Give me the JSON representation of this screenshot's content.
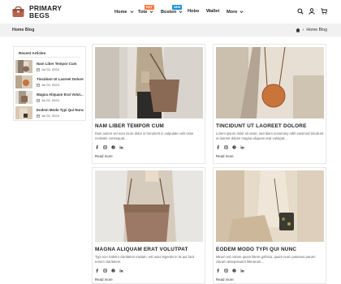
{
  "brand": {
    "line1": "PRIMARY",
    "line2": "BEGS"
  },
  "nav": {
    "items": [
      {
        "label": "Home",
        "has_caret": true,
        "badge": ""
      },
      {
        "label": "Tote",
        "has_caret": true,
        "badge": "HOT"
      },
      {
        "label": "Boston",
        "has_caret": true,
        "badge": "NEW"
      },
      {
        "label": "Hobo",
        "has_caret": false,
        "badge": ""
      },
      {
        "label": "Wallet",
        "has_caret": false,
        "badge": ""
      },
      {
        "label": "More",
        "has_caret": true,
        "badge": ""
      }
    ],
    "icons": [
      "search-icon",
      "user-icon",
      "cart-icon"
    ]
  },
  "breadcrumb": {
    "title": "Home Blog",
    "home_icon": "home-icon",
    "separator": "›",
    "current": "Home Blog"
  },
  "sidebar": {
    "title": "Recent Articles",
    "items": [
      {
        "name": "Nam Liber Tempor Cum",
        "date": "Jul 02, 2024"
      },
      {
        "name": "Tincidunt Ut Laoreet Dolore",
        "date": "Jul 02, 2024"
      },
      {
        "name": "Magna Aliquam Erat Volut...",
        "date": "Jul 02, 2024"
      },
      {
        "name": "Eodem Modo Typi Qui Nunc",
        "date": "Jul 02, 2024"
      }
    ]
  },
  "posts": [
    {
      "title": "NAM LIBER TEMPOR CUM",
      "excerpt": "Duis autem vel eum iriure dolor in hendrerit in vulputate velit esse molestie consequat...",
      "read_more": "Read more"
    },
    {
      "title": "TINCIDUNT UT LAOREET DOLORE",
      "excerpt": "Lorem ipsum dolor sit amet, sed diam nonummy nibh euismod tincidunt ut laoreet dolore magna aliquam erat volutpat...",
      "read_more": "Read more"
    },
    {
      "title": "MAGNA ALIQUAM ERAT VOLUTPAT",
      "excerpt": "Typi non habent claritatem insitam; est usus legentis in iis qui facit eorum claritatem.",
      "read_more": "Read more"
    },
    {
      "title": "EODEM MODO TYPI QUI NUNC",
      "excerpt": "Mirum est notare quam littera gothica, quam nunc putamus parum claram anteposuerit litterarum...",
      "read_more": "Read more"
    }
  ],
  "social_icons": [
    "facebook-icon",
    "instagram-icon",
    "pinterest-icon",
    "linkedin-icon"
  ],
  "colors": {
    "badge_hot": "#ff7c42",
    "badge_new": "#1890d6",
    "bag_brown": "#8b6a55",
    "bag_orange": "#c8743a"
  }
}
